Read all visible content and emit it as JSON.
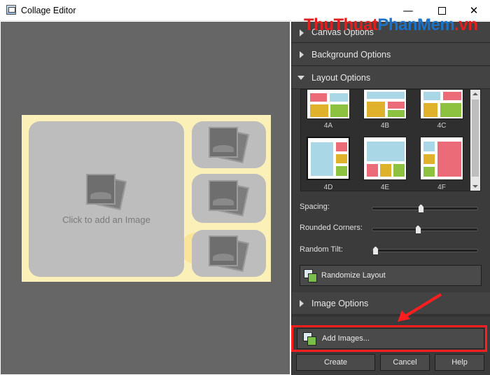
{
  "window": {
    "title": "Collage Editor",
    "minimize": "—",
    "close": "✕"
  },
  "canvas": {
    "placeholder": "Click to add an Image"
  },
  "watermark": {
    "part1": "ThuThuat",
    "part2": "PhanMem",
    "part3": ".vn"
  },
  "sections": {
    "canvas_options": "Canvas Options",
    "background_options": "Background Options",
    "layout_options": "Layout Options",
    "image_options": "Image Options"
  },
  "layouts": [
    {
      "label": "4A",
      "selected": false
    },
    {
      "label": "4B",
      "selected": false
    },
    {
      "label": "4C",
      "selected": false
    },
    {
      "label": "4D",
      "selected": true
    },
    {
      "label": "4E",
      "selected": false
    },
    {
      "label": "4F",
      "selected": false
    }
  ],
  "sliders": {
    "spacing": {
      "label": "Spacing:",
      "value": 0.46
    },
    "rounded_corners": {
      "label": "Rounded Corners:",
      "value": 0.43
    },
    "random_tilt": {
      "label": "Random Tilt:",
      "value": 0.0
    }
  },
  "buttons": {
    "randomize": "Randomize Layout",
    "add_images": "Add Images...",
    "create": "Create",
    "cancel": "Cancel",
    "help": "Help"
  },
  "colors": {
    "highlight": "#ff1e1e",
    "panel": "#3b3b3b",
    "canvas": "#666666"
  }
}
